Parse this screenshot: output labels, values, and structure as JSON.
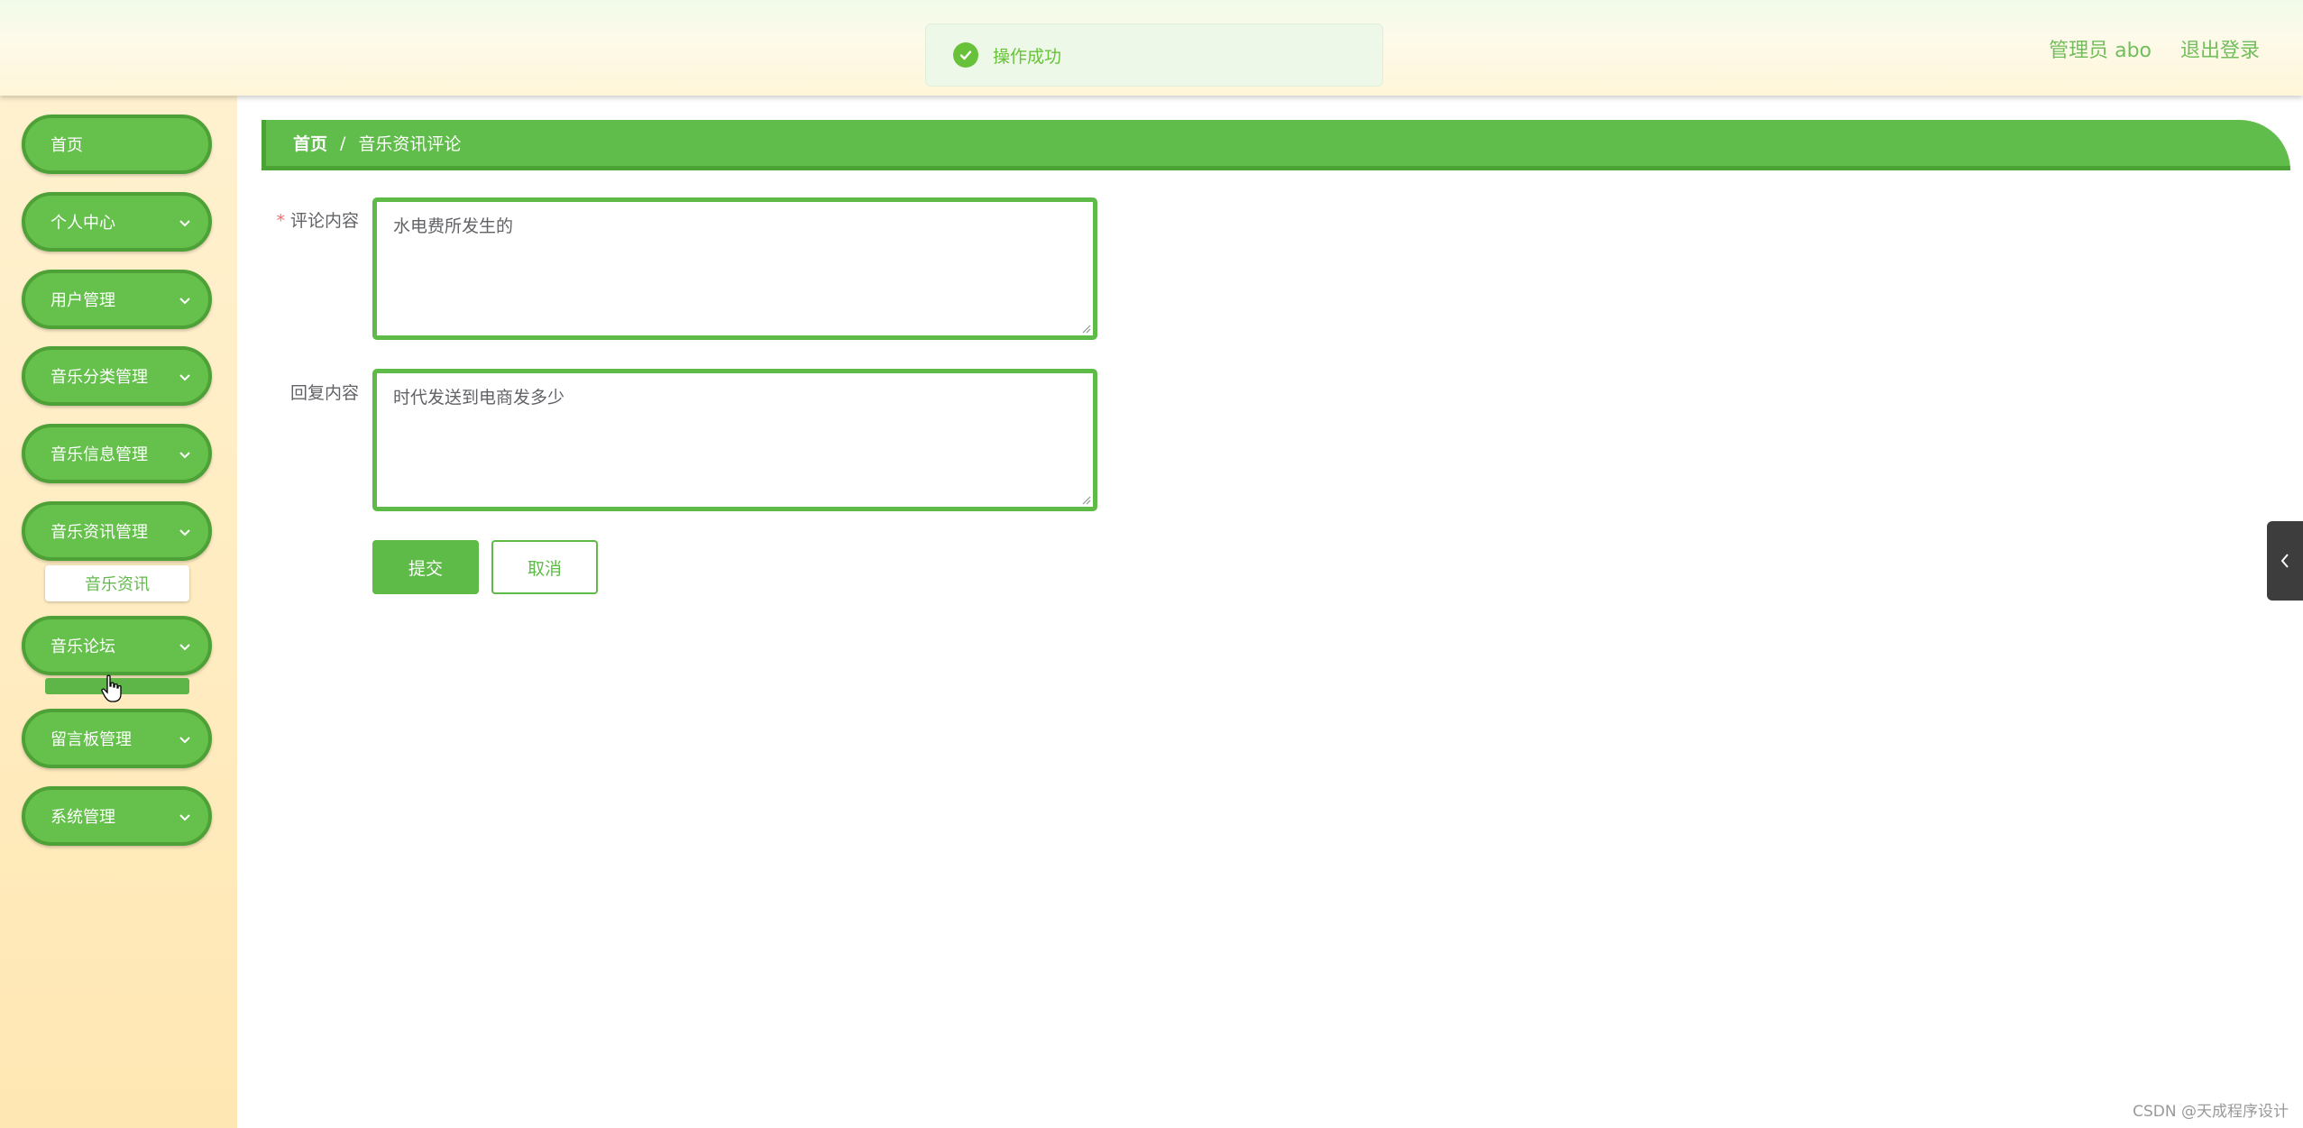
{
  "header": {
    "user_label": "管理员 abo",
    "logout_label": "退出登录",
    "toast_text": "操作成功"
  },
  "sidebar": {
    "items": [
      {
        "label": "首页",
        "has_chevron": false
      },
      {
        "label": "个人中心",
        "has_chevron": true
      },
      {
        "label": "用户管理",
        "has_chevron": true
      },
      {
        "label": "音乐分类管理",
        "has_chevron": true
      },
      {
        "label": "音乐信息管理",
        "has_chevron": true
      },
      {
        "label": "音乐资讯管理",
        "has_chevron": true
      },
      {
        "label": "音乐论坛",
        "has_chevron": true
      },
      {
        "label": "留言板管理",
        "has_chevron": true
      },
      {
        "label": "系统管理",
        "has_chevron": true
      }
    ],
    "submenu_news": "音乐资讯"
  },
  "breadcrumb": {
    "home": "首页",
    "separator": "/",
    "current": "音乐资讯评论"
  },
  "form": {
    "comment_label": "评论内容",
    "comment_required": "*",
    "comment_value": "水电费所发生的",
    "reply_label": "回复内容",
    "reply_value": "时代发送到电商发多少",
    "submit_label": "提交",
    "cancel_label": "取消"
  },
  "watermark": "CSDN @天成程序设计",
  "colors": {
    "accent": "#5ebb48",
    "accent_dark": "#4ba235",
    "sidebar_bg": "#ffe7b3",
    "success": "#67c23a"
  },
  "icons": [
    "check-circle-icon",
    "chevron-down-icon",
    "chevron-left-icon",
    "hand-cursor-icon"
  ]
}
